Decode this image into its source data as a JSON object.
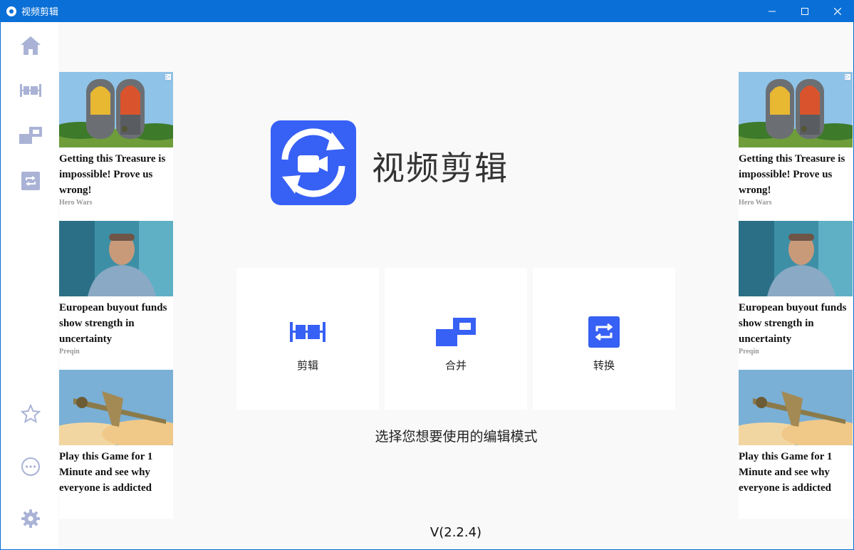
{
  "window": {
    "title": "视频剪辑",
    "minimize": "—",
    "maximize": "☐",
    "close": "✕"
  },
  "sidebar": {
    "items": [
      {
        "icon": "home-icon"
      },
      {
        "icon": "trim-icon"
      },
      {
        "icon": "merge-icon"
      },
      {
        "icon": "convert-icon"
      },
      {
        "icon": "star-icon"
      },
      {
        "icon": "more-icon"
      },
      {
        "icon": "gear-icon"
      }
    ]
  },
  "ads": [
    {
      "title": "Getting this Treasure is impossible! Prove us wrong!",
      "source": "Hero Wars"
    },
    {
      "title": "European buyout funds show strength in uncertainty",
      "source": "Preqin"
    },
    {
      "title": "Play this Game for 1 Minute and see why everyone is addicted",
      "source": ""
    }
  ],
  "ad_badge": "▷",
  "main": {
    "app_name": "视频剪辑",
    "modes": [
      {
        "label": "剪辑",
        "icon": "trim-icon"
      },
      {
        "label": "合并",
        "icon": "merge-icon"
      },
      {
        "label": "转换",
        "icon": "convert-icon"
      }
    ],
    "prompt": "选择您想要使用的编辑模式",
    "version": "V(2.2.4)"
  },
  "colors": {
    "titlebar": "#0a6fd6",
    "accent": "#3760f5",
    "sidebar_icon": "#aab3d6"
  }
}
